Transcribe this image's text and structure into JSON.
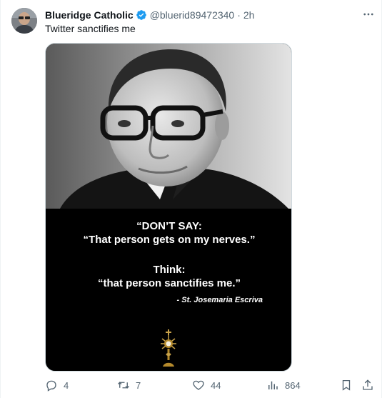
{
  "tweet": {
    "author_name": "Blueridge Catholic",
    "handle": "@bluerid89472340",
    "separator": "·",
    "time": "2h",
    "text": "Twitter sanctifies me",
    "verified": true
  },
  "media": {
    "quote_line1": "“DON’T SAY:",
    "quote_line2": "“That person gets on my nerves.”",
    "quote_line3": "Think:",
    "quote_line4": "“that person sanctifies me.”",
    "attribution": "- St. Josemaria Escriva"
  },
  "actions": {
    "replies": "4",
    "retweets": "7",
    "likes": "44",
    "views": "864"
  },
  "colors": {
    "text_primary": "#0f1419",
    "text_secondary": "#536471",
    "verified_blue": "#1d9bf0",
    "media_bg": "#000000"
  },
  "icons": [
    "avatar",
    "verified-badge-icon",
    "more-icon",
    "reply-icon",
    "retweet-icon",
    "like-icon",
    "views-icon",
    "bookmark-icon",
    "share-icon",
    "monstrance-icon"
  ]
}
